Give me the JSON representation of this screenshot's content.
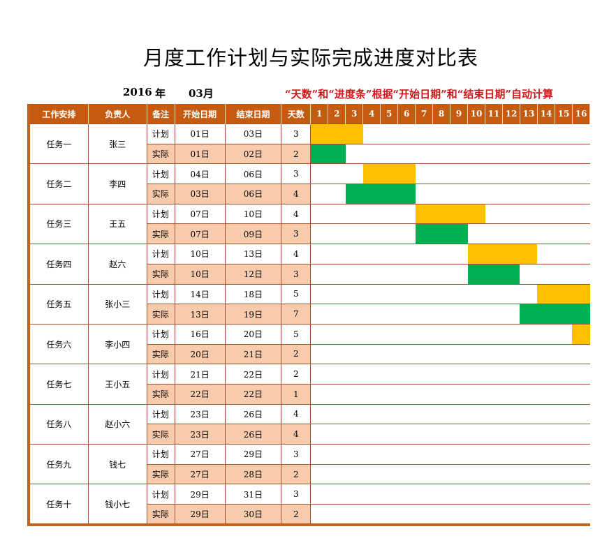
{
  "title": "月度工作计划与实际完成进度对比表",
  "period": {
    "year": "2016",
    "year_label": "年",
    "month": "03月"
  },
  "note": "“天数”和“进度条”根据“开始日期”和“结束日期”自动计算",
  "headers": {
    "task": "工作安排",
    "owner": "负责人",
    "type": "备注",
    "start": "开始日期",
    "end": "结束日期",
    "days": "天数"
  },
  "day_columns": [
    "1",
    "2",
    "3",
    "4",
    "5",
    "6",
    "7",
    "8",
    "9",
    "10",
    "11",
    "12",
    "13",
    "14",
    "15",
    "16"
  ],
  "colors": {
    "header": "#c55a11",
    "plan_bar": "#ffc000",
    "actual_bar": "#00b050",
    "actual_row": "#f8cbad",
    "note": "#d0161b"
  },
  "tasks": [
    {
      "name": "任务一",
      "owner": "张三",
      "plan": {
        "label": "计划",
        "start": "01日",
        "end": "03日",
        "days": "3",
        "s": 1,
        "e": 3
      },
      "actual": {
        "label": "实际",
        "start": "01日",
        "end": "02日",
        "days": "2",
        "s": 1,
        "e": 2
      }
    },
    {
      "name": "任务二",
      "owner": "李四",
      "plan": {
        "label": "计划",
        "start": "04日",
        "end": "06日",
        "days": "3",
        "s": 4,
        "e": 6
      },
      "actual": {
        "label": "实际",
        "start": "03日",
        "end": "06日",
        "days": "4",
        "s": 3,
        "e": 6
      }
    },
    {
      "name": "任务三",
      "owner": "王五",
      "plan": {
        "label": "计划",
        "start": "07日",
        "end": "10日",
        "days": "4",
        "s": 7,
        "e": 10
      },
      "actual": {
        "label": "实际",
        "start": "07日",
        "end": "09日",
        "days": "3",
        "s": 7,
        "e": 9
      }
    },
    {
      "name": "任务四",
      "owner": "赵六",
      "plan": {
        "label": "计划",
        "start": "10日",
        "end": "13日",
        "days": "4",
        "s": 10,
        "e": 13
      },
      "actual": {
        "label": "实际",
        "start": "10日",
        "end": "12日",
        "days": "3",
        "s": 10,
        "e": 12
      }
    },
    {
      "name": "任务五",
      "owner": "张小三",
      "plan": {
        "label": "计划",
        "start": "14日",
        "end": "18日",
        "days": "5",
        "s": 14,
        "e": 18
      },
      "actual": {
        "label": "实际",
        "start": "13日",
        "end": "19日",
        "days": "7",
        "s": 13,
        "e": 19
      }
    },
    {
      "name": "任务六",
      "owner": "李小四",
      "plan": {
        "label": "计划",
        "start": "16日",
        "end": "20日",
        "days": "5",
        "s": 16,
        "e": 20
      },
      "actual": {
        "label": "实际",
        "start": "20日",
        "end": "21日",
        "days": "2",
        "s": 20,
        "e": 21
      }
    },
    {
      "name": "任务七",
      "owner": "王小五",
      "plan": {
        "label": "计划",
        "start": "21日",
        "end": "22日",
        "days": "2",
        "s": 21,
        "e": 22
      },
      "actual": {
        "label": "实际",
        "start": "22日",
        "end": "22日",
        "days": "1",
        "s": 22,
        "e": 22
      }
    },
    {
      "name": "任务八",
      "owner": "赵小六",
      "plan": {
        "label": "计划",
        "start": "23日",
        "end": "26日",
        "days": "4",
        "s": 23,
        "e": 26
      },
      "actual": {
        "label": "实际",
        "start": "23日",
        "end": "26日",
        "days": "4",
        "s": 23,
        "e": 26
      }
    },
    {
      "name": "任务九",
      "owner": "钱七",
      "plan": {
        "label": "计划",
        "start": "27日",
        "end": "29日",
        "days": "3",
        "s": 27,
        "e": 29
      },
      "actual": {
        "label": "实际",
        "start": "27日",
        "end": "28日",
        "days": "2",
        "s": 27,
        "e": 28
      }
    },
    {
      "name": "任务十",
      "owner": "钱小七",
      "plan": {
        "label": "计划",
        "start": "29日",
        "end": "31日",
        "days": "3",
        "s": 29,
        "e": 31
      },
      "actual": {
        "label": "实际",
        "start": "29日",
        "end": "30日",
        "days": "2",
        "s": 29,
        "e": 30
      }
    }
  ]
}
